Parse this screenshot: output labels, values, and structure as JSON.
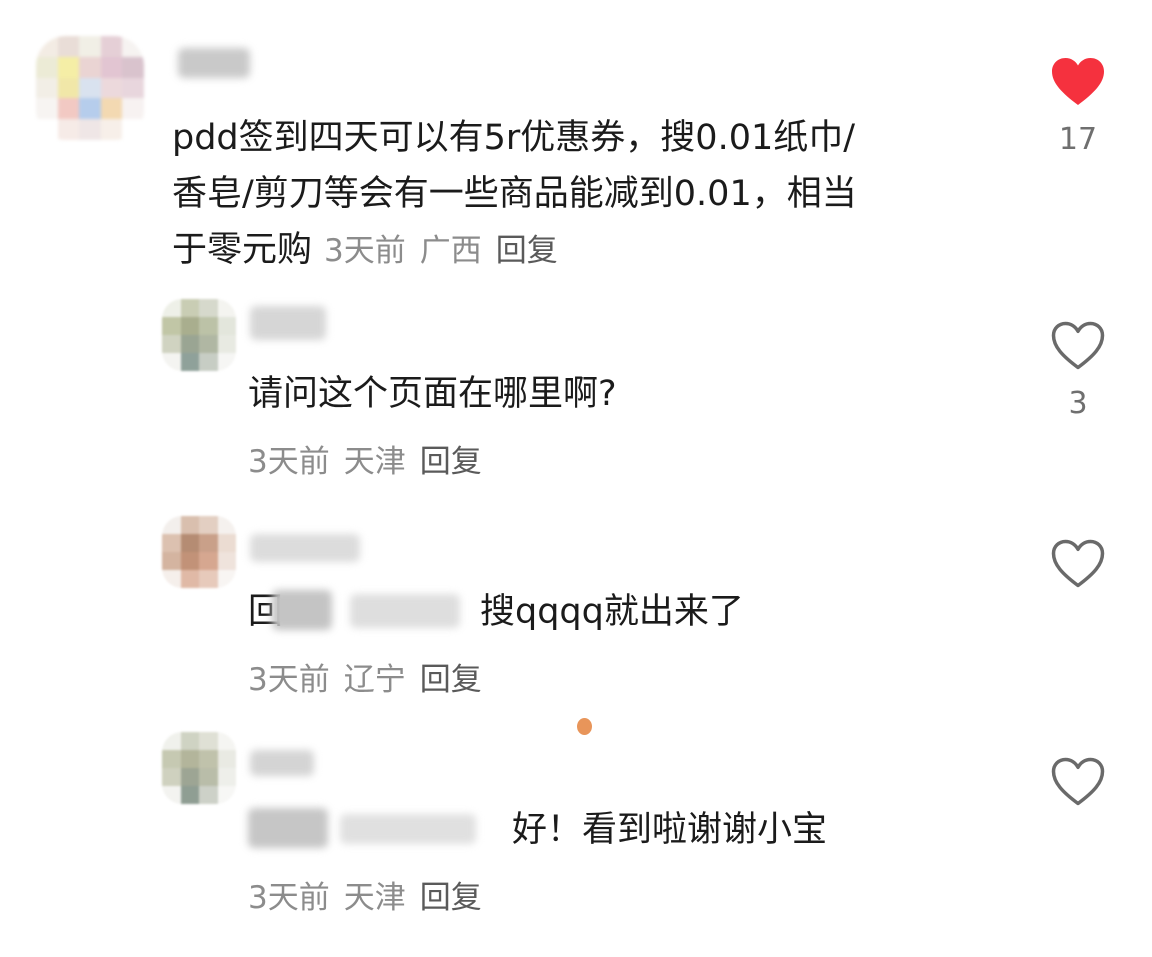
{
  "comments": [
    {
      "text_lines": [
        "pdd签到四天可以有5r优惠券，搜0.01纸巾/",
        "香皂/剪刀等会有一些商品能减到0.01，相当",
        "于零元购"
      ],
      "time": "3天前",
      "location": "广西",
      "reply_label": "回复",
      "likes": "17",
      "liked": true,
      "like_color": "#f5313e"
    },
    {
      "text": "请问这个页面在哪里啊?",
      "time": "3天前",
      "location": "天津",
      "reply_label": "回复",
      "likes": "3",
      "liked": false
    },
    {
      "text_prefix_visible": "回",
      "text": "搜qqqq就出来了",
      "time": "3天前",
      "location": "辽宁",
      "reply_label": "回复",
      "likes": "",
      "liked": false
    },
    {
      "text": "好！看到啦谢谢小宝",
      "time": "3天前",
      "location": "天津",
      "reply_label": "回复",
      "likes": "",
      "liked": false
    }
  ],
  "colors": {
    "liked_heart": "#f5313e",
    "outline_heart": "#6a6a6a",
    "meta_text": "#8c8c8c",
    "body_text": "#1b1b1b"
  },
  "icons": {
    "liked": "heart-filled-icon",
    "unliked": "heart-outline-icon"
  }
}
